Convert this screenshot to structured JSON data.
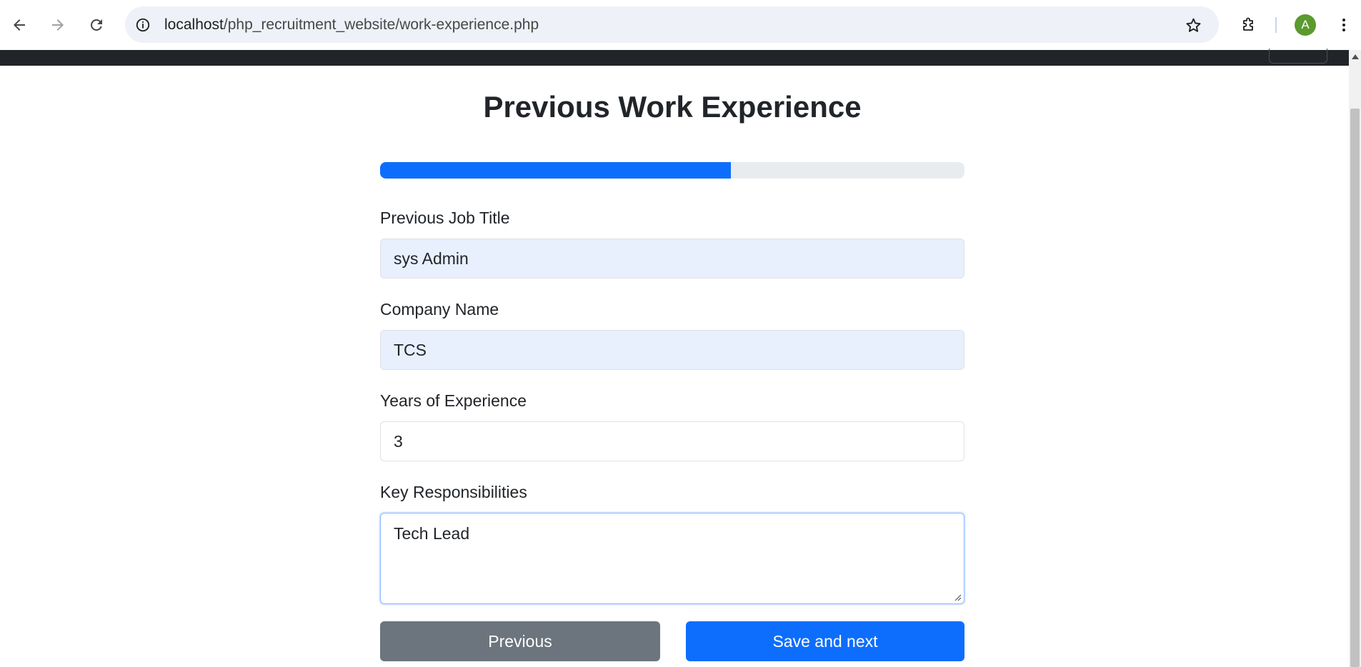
{
  "browser": {
    "url_host": "localhost",
    "url_path": "/php_recruitment_website/work-experience.php",
    "profile_initial": "A"
  },
  "page": {
    "title": "Previous Work Experience",
    "progress_percent": 60,
    "accent_color": "#0d6efd"
  },
  "form": {
    "job_title": {
      "label": "Previous Job Title",
      "value": "sys Admin"
    },
    "company": {
      "label": "Company Name",
      "value": "TCS"
    },
    "years": {
      "label": "Years of Experience",
      "value": "3"
    },
    "responsibilities": {
      "label": "Key Responsibilities",
      "value": "Tech Lead"
    }
  },
  "buttons": {
    "previous": "Previous",
    "next": "Save and next"
  },
  "icons": {
    "back": "arrow-left-icon",
    "forward": "arrow-right-icon",
    "reload": "reload-icon",
    "site_info": "info-icon",
    "bookmark": "star-icon",
    "extensions": "puzzle-icon",
    "menu": "kebab-menu-icon"
  }
}
